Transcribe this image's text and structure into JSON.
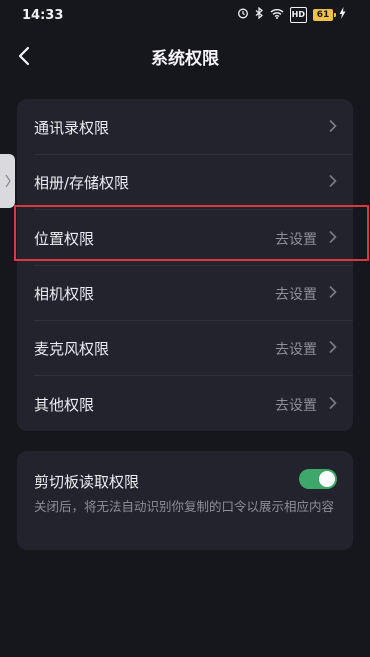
{
  "status_bar": {
    "time": "14:33",
    "network_badge": "HD",
    "battery_level": "61",
    "icons": [
      "alarm-icon",
      "bluetooth-icon",
      "wifi-icon",
      "hd-icon",
      "battery-icon",
      "charging-icon"
    ]
  },
  "header": {
    "title": "系统权限",
    "back_icon": "chevron-left-icon"
  },
  "permissions": [
    {
      "label": "通讯录权限",
      "status": ""
    },
    {
      "label": "相册/存储权限",
      "status": ""
    },
    {
      "label": "位置权限",
      "status": "去设置"
    },
    {
      "label": "相机权限",
      "status": "去设置"
    },
    {
      "label": "麦克风权限",
      "status": "去设置"
    },
    {
      "label": "其他权限",
      "status": "去设置"
    }
  ],
  "clipboard": {
    "title": "剪切板读取权限",
    "description": "关闭后，将无法自动识别你复制的口令以展示相应内容",
    "enabled": true
  },
  "colors": {
    "background": "#16161d",
    "card": "#23232d",
    "toggle_on": "#3ea76a",
    "highlight": "#d9383f",
    "battery": "#f0c24b"
  }
}
